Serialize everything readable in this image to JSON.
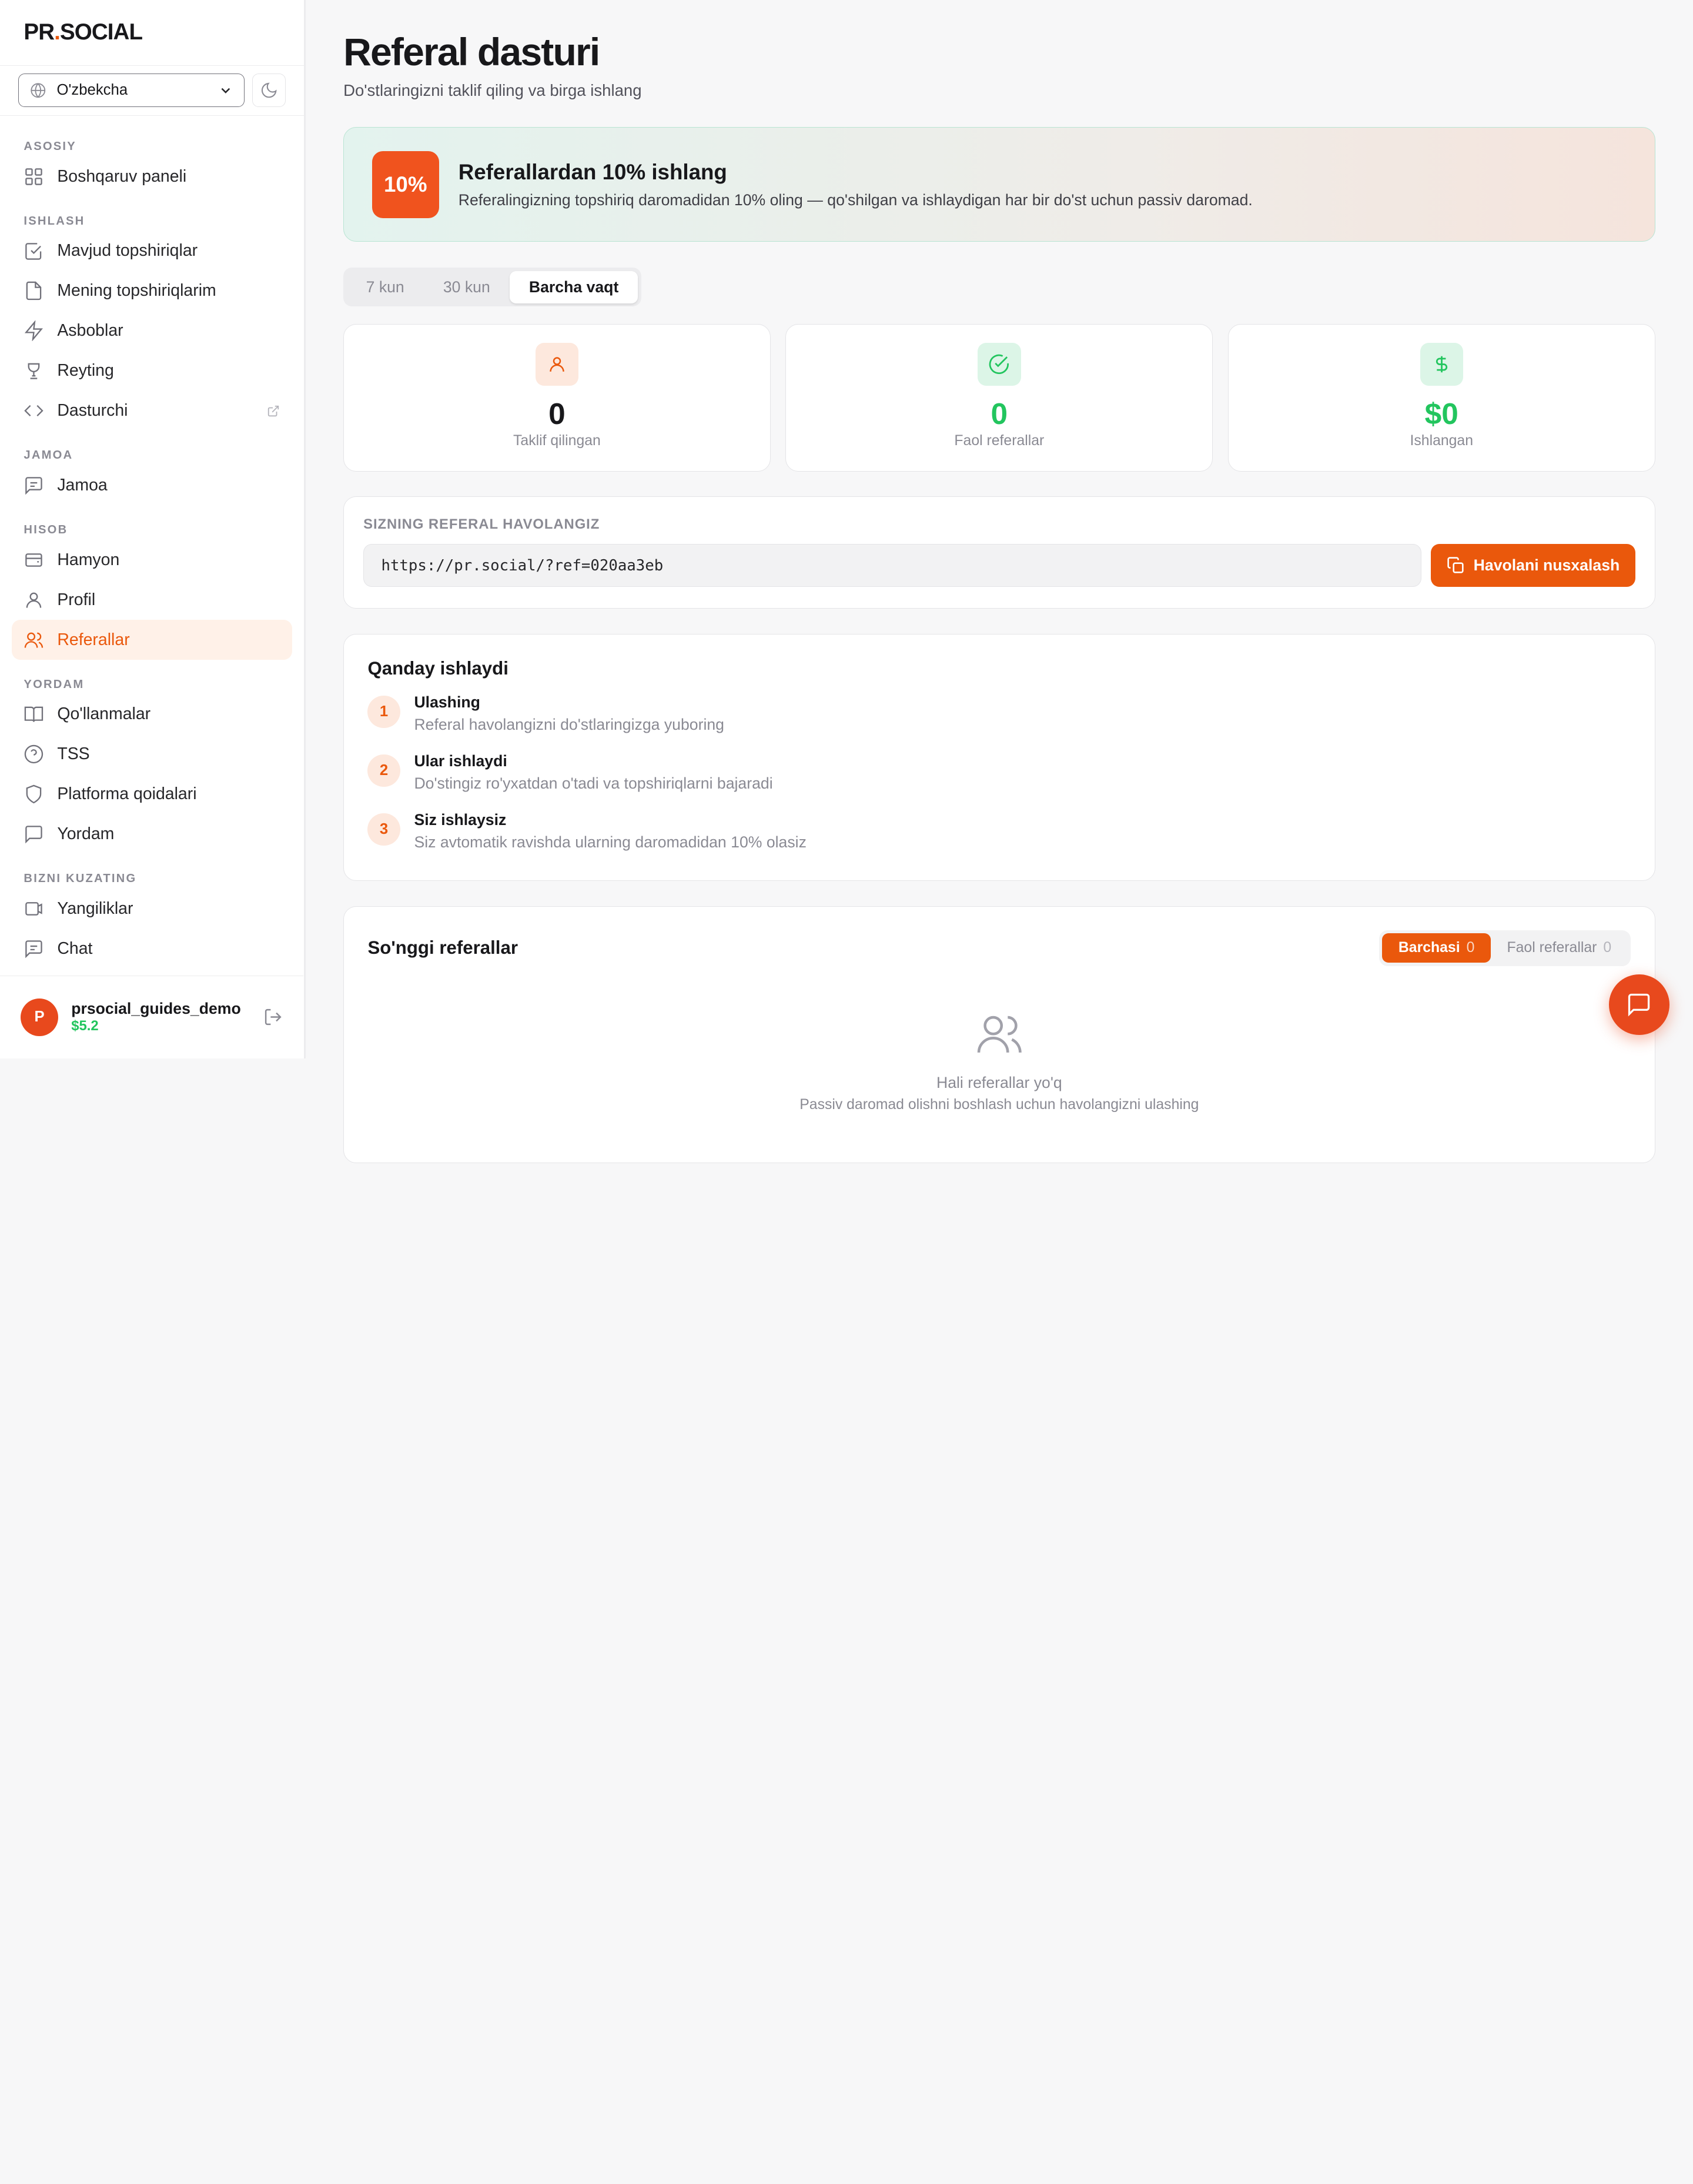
{
  "brand": {
    "logo_left": "PR",
    "logo_dot": ".",
    "logo_right": "SOCIAL"
  },
  "language": {
    "selected": "O'zbekcha"
  },
  "nav": {
    "group_main": "ASOSIY",
    "dashboard": "Boshqaruv paneli",
    "group_earn": "ISHLASH",
    "available_tasks": "Mavjud topshiriqlar",
    "my_tasks": "Mening topshiriqlarim",
    "tools": "Asboblar",
    "rating": "Reyting",
    "developer": "Dasturchi",
    "group_team": "JAMOA",
    "team": "Jamoa",
    "group_account": "HISOB",
    "wallet": "Hamyon",
    "profile": "Profil",
    "referrals": "Referallar",
    "group_help": "YORDAM",
    "guides": "Qo'llanmalar",
    "faq": "TSS",
    "rules": "Platforma qoidalari",
    "support": "Yordam",
    "group_follow": "BIZNI KUZATING",
    "news": "Yangiliklar",
    "chat": "Chat"
  },
  "user": {
    "initial": "P",
    "name": "prsocial_guides_demo",
    "balance": "$5.2"
  },
  "page": {
    "title": "Referal dasturi",
    "subtitle": "Do'stlaringizni taklif qiling va birga ishlang"
  },
  "banner": {
    "badge": "10%",
    "title": "Referallardan 10% ishlang",
    "text": "Referalingizning topshiriq daromadidan 10% oling — qo'shilgan va ishlaydigan har bir do'st uchun passiv daromad."
  },
  "range_tabs": [
    "7 kun",
    "30 kun",
    "Barcha vaqt"
  ],
  "range_selected": "Barcha vaqt",
  "stats": [
    {
      "value": "0",
      "label": "Taklif qilingan",
      "color": "#18181b"
    },
    {
      "value": "0",
      "label": "Faol referallar",
      "color": "#22c55e"
    },
    {
      "value": "$0",
      "label": "Ishlangan",
      "color": "#22c55e"
    }
  ],
  "referral_link": {
    "label": "SIZNING REFERAL HAVOLANGIZ",
    "url": "https://pr.social/?ref=020aa3eb",
    "copy_label": "Havolani nusxalash"
  },
  "how_it_works": {
    "title": "Qanday ishlaydi",
    "steps": [
      {
        "num": "1",
        "title": "Ulashing",
        "desc": "Referal havolangizni do'stlaringizga yuboring"
      },
      {
        "num": "2",
        "title": "Ular ishlaydi",
        "desc": "Do'stingiz ro'yxatdan o'tadi va topshiriqlarni bajaradi"
      },
      {
        "num": "3",
        "title": "Siz ishlaysiz",
        "desc": "Siz avtomatik ravishda ularning daromadidan 10% olasiz"
      }
    ]
  },
  "recent": {
    "title": "So'nggi referallar",
    "filter_all": "Barchasi",
    "filter_all_count": "0",
    "filter_active": "Faol referallar",
    "filter_active_count": "0",
    "empty_title": "Hali referallar yo'q",
    "empty_desc": "Passiv daromad olishni boshlash uchun havolangizni ulashing"
  },
  "colors": {
    "accent": "#ea580c",
    "success": "#22c55e"
  }
}
